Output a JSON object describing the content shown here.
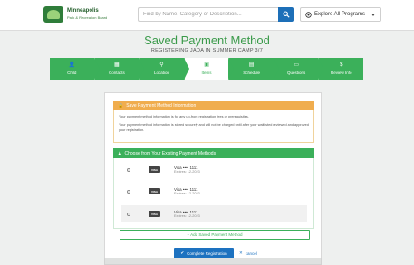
{
  "header": {
    "logo_line1": "Minneapolis",
    "logo_line2": "Park & Recreation Board",
    "search_placeholder": "Find by Name, Category or Description...",
    "explore_label": "Explore All Programs"
  },
  "title": {
    "main": "Saved Payment Method",
    "sub": "REGISTERING JADA IN SUMMER CAMP 3/7"
  },
  "steps": [
    {
      "label": "Child",
      "icon": "👤",
      "active": false
    },
    {
      "label": "Contacts",
      "icon": "▦",
      "active": false
    },
    {
      "label": "Location",
      "icon": "⚲",
      "active": false
    },
    {
      "label": "Items",
      "icon": "▣",
      "active": true
    },
    {
      "label": "Schedule",
      "icon": "▤",
      "active": false
    },
    {
      "label": "Questions",
      "icon": "▭",
      "active": false
    },
    {
      "label": "Review Info",
      "icon": "$",
      "active": false
    }
  ],
  "save_panel": {
    "heading": "Save Payment Method Information",
    "text1": "Your payment method information is for any up-front registration fees or prerequisites.",
    "text2": "Your payment method information is stored securely and will not be charged until after your waitlisted reviewed and approved your registration."
  },
  "payments": {
    "heading": "Choose from Your Existing Payment Methods",
    "cards": [
      {
        "brand": "VISA",
        "number": "Visa •••• 1111",
        "expires": "Expires: 12-2023"
      },
      {
        "brand": "VISA",
        "number": "Visa •••• 1111",
        "expires": "Expires: 12-2023"
      },
      {
        "brand": "VISA",
        "number": "Visa •••• 1111",
        "expires": "Expires: 12-2023"
      }
    ],
    "add_label": "+ Add Saved Payment Method"
  },
  "actions": {
    "complete_label": "Complete Registration",
    "cancel_label": "cancel"
  },
  "colors": {
    "green": "#3bb05a",
    "orange": "#f0ad4e",
    "blue": "#1d72c0"
  }
}
